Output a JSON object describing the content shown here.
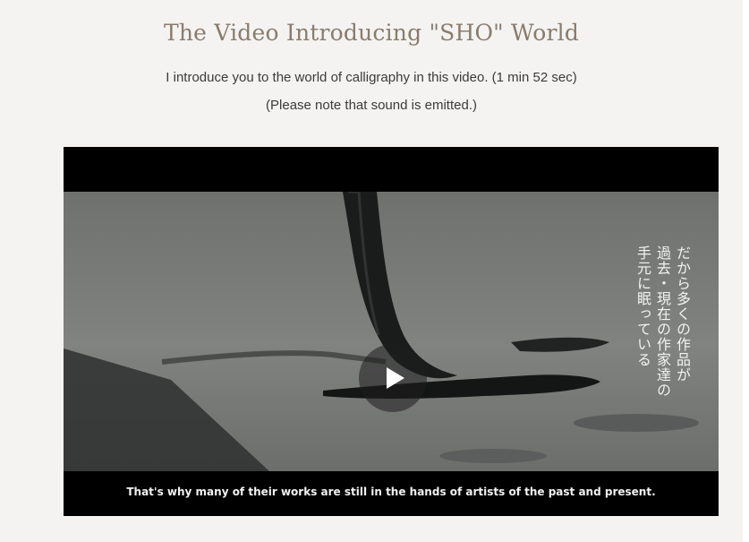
{
  "header": {
    "title": "The Video Introducing \"SHO\" World",
    "description_line1": "I introduce you to the world of calligraphy in this video. (1 min 52 sec)",
    "description_line2": "(Please note that sound is emitted.)"
  },
  "video": {
    "vertical_overlay_col1": "だから多くの作品が",
    "vertical_overlay_col2": "過去・現在の作家達の",
    "vertical_overlay_col3": "手元に眠っている",
    "caption": "That's why many of their works are still in the hands of artists of the past and present.",
    "play_icon": "play-icon"
  },
  "colors": {
    "page_background": "#f4f3f1",
    "title_color": "#8a7c6c",
    "text_color": "#3b3b3b",
    "video_background": "#000000"
  }
}
